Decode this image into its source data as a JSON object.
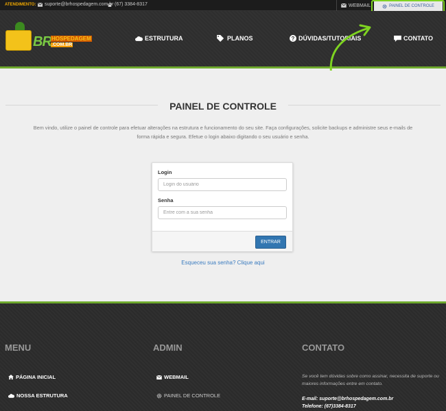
{
  "topbar": {
    "attendance_label": "ATENDIMENTO:",
    "email": "suporte@brhospedagem.com.br",
    "phone": "(67) 3384-8317",
    "webmail": "WEBMAIL",
    "control_panel": "PAINEL DE CONTROLE"
  },
  "logo": {
    "br": "BR",
    "hospedagem": "HOSPEDAGEM",
    "com": ".COM.BR"
  },
  "nav": [
    {
      "label": "ESTRUTURA",
      "icon": "cloud-icon"
    },
    {
      "label": "PLANOS",
      "icon": "tags-icon"
    },
    {
      "label": "DÚVIDAS/TUTORIAIS",
      "icon": "question-icon"
    },
    {
      "label": "CONTATO",
      "icon": "chat-icon"
    }
  ],
  "main": {
    "title": "PAINEL DE CONTROLE",
    "intro_line1": "Bem vindo, utilize o painel de controle para efetuar alterações na estrutura e funcionamento do seu site. Faça configurações, solicite backups e administre seus e-mails de",
    "intro_line2": "forma rápida e segura. Efetue o login abaixo digitando o seu usuário e senha."
  },
  "login_form": {
    "login_label": "Login",
    "login_placeholder": "Login do usuário",
    "password_label": "Senha",
    "password_placeholder": "Entre com a sua senha",
    "submit": "ENTRAR",
    "forgot": "Esqueceu sua senha? Clique aqui"
  },
  "footer": {
    "menu_title": "MENU",
    "menu_items": [
      "PÁGINA INICIAL",
      "NOSSA ESTRUTURA"
    ],
    "admin_title": "ADMIN",
    "admin_items": [
      "WEBMAIL",
      "PAINEL DE CONTROLE"
    ],
    "contact_title": "CONTATO",
    "contact_text": "Se você tem dúvidas sobre como assinar, necessita de suporte ou maiores informações entre em contato.",
    "contact_email": "E-mail: suporte@brhospedagem.com.br",
    "contact_phone": "Telefone: (67)3384-8317"
  },
  "colors": {
    "accent_green": "#6ea92d",
    "highlight_green": "#7ed321",
    "button_blue": "#3276b1"
  }
}
